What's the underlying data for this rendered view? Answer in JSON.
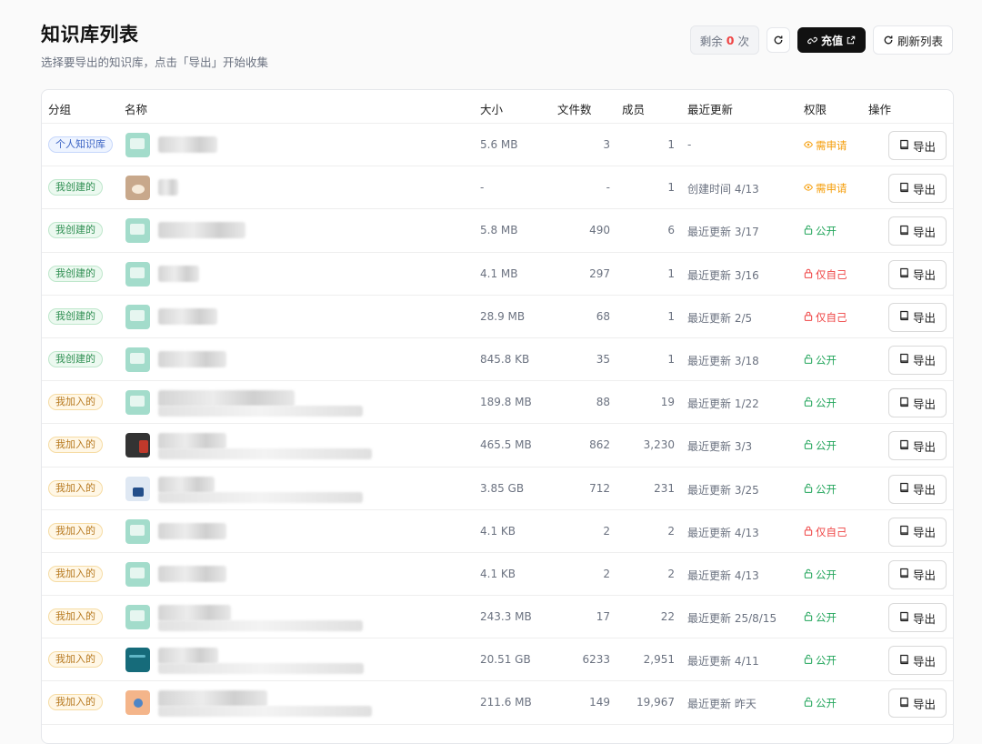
{
  "header": {
    "title": "知识库列表",
    "subtitle": "选择要导出的知识库，点击「导出」开始收集"
  },
  "actions": {
    "remaining_prefix": "剩余",
    "remaining_count": "0",
    "remaining_suffix": "次",
    "recharge_label": "充值",
    "refresh_label": "刷新列表"
  },
  "table": {
    "headers": {
      "group": "分组",
      "name": "名称",
      "size": "大小",
      "files": "文件数",
      "members": "成员",
      "updated": "最近更新",
      "permission": "权限",
      "action": "操作"
    },
    "export_label": "导出",
    "rows": [
      {
        "group": "个人知识库",
        "group_style": "blue",
        "thumb": "default",
        "size": "5.6 MB",
        "files": "3",
        "members": "1",
        "updated": "-",
        "permission": "需申请",
        "perm_style": "orange",
        "perm_icon": "eye-icon"
      },
      {
        "group": "我创建的",
        "group_style": "green",
        "thumb": "brown",
        "size": "-",
        "files": "-",
        "members": "1",
        "updated": "创建时间 4/13",
        "permission": "需申请",
        "perm_style": "orange",
        "perm_icon": "eye-icon"
      },
      {
        "group": "我创建的",
        "group_style": "green",
        "thumb": "default",
        "size": "5.8 MB",
        "files": "490",
        "members": "6",
        "updated": "最近更新 3/17",
        "permission": "公开",
        "perm_style": "green",
        "perm_icon": "lock-open-icon"
      },
      {
        "group": "我创建的",
        "group_style": "green",
        "thumb": "default",
        "size": "4.1 MB",
        "files": "297",
        "members": "1",
        "updated": "最近更新 3/16",
        "permission": "仅自己",
        "perm_style": "red",
        "perm_icon": "lock-icon"
      },
      {
        "group": "我创建的",
        "group_style": "green",
        "thumb": "default",
        "size": "28.9 MB",
        "files": "68",
        "members": "1",
        "updated": "最近更新 2/5",
        "permission": "仅自己",
        "perm_style": "red",
        "perm_icon": "lock-icon"
      },
      {
        "group": "我创建的",
        "group_style": "green",
        "thumb": "default",
        "size": "845.8 KB",
        "files": "35",
        "members": "1",
        "updated": "最近更新 3/18",
        "permission": "公开",
        "perm_style": "green",
        "perm_icon": "lock-open-icon"
      },
      {
        "group": "我加入的",
        "group_style": "amber",
        "thumb": "default",
        "size": "189.8 MB",
        "files": "88",
        "members": "19",
        "updated": "最近更新 1/22",
        "permission": "公开",
        "perm_style": "green",
        "perm_icon": "lock-open-icon"
      },
      {
        "group": "我加入的",
        "group_style": "amber",
        "thumb": "dark",
        "size": "465.5 MB",
        "files": "862",
        "members": "3,230",
        "updated": "最近更新 3/3",
        "permission": "公开",
        "perm_style": "green",
        "perm_icon": "lock-open-icon"
      },
      {
        "group": "我加入的",
        "group_style": "amber",
        "thumb": "photo",
        "size": "3.85 GB",
        "files": "712",
        "members": "231",
        "updated": "最近更新 3/25",
        "permission": "公开",
        "perm_style": "green",
        "perm_icon": "lock-open-icon"
      },
      {
        "group": "我加入的",
        "group_style": "amber",
        "thumb": "default",
        "size": "4.1 KB",
        "files": "2",
        "members": "2",
        "updated": "最近更新 4/13",
        "permission": "仅自己",
        "perm_style": "red",
        "perm_icon": "lock-icon"
      },
      {
        "group": "我加入的",
        "group_style": "amber",
        "thumb": "default",
        "size": "4.1 KB",
        "files": "2",
        "members": "2",
        "updated": "最近更新 4/13",
        "permission": "公开",
        "perm_style": "green",
        "perm_icon": "lock-open-icon"
      },
      {
        "group": "我加入的",
        "group_style": "amber",
        "thumb": "default",
        "size": "243.3 MB",
        "files": "17",
        "members": "22",
        "updated": "最近更新 25/8/15",
        "permission": "公开",
        "perm_style": "green",
        "perm_icon": "lock-open-icon"
      },
      {
        "group": "我加入的",
        "group_style": "amber",
        "thumb": "teal",
        "size": "20.51 GB",
        "files": "6233",
        "members": "2,951",
        "updated": "最近更新 4/11",
        "permission": "公开",
        "perm_style": "green",
        "perm_icon": "lock-open-icon"
      },
      {
        "group": "我加入的",
        "group_style": "amber",
        "thumb": "orange",
        "size": "211.6 MB",
        "files": "149",
        "members": "19,967",
        "updated": "最近更新 昨天",
        "permission": "公开",
        "perm_style": "green",
        "perm_icon": "lock-open-icon"
      }
    ]
  }
}
